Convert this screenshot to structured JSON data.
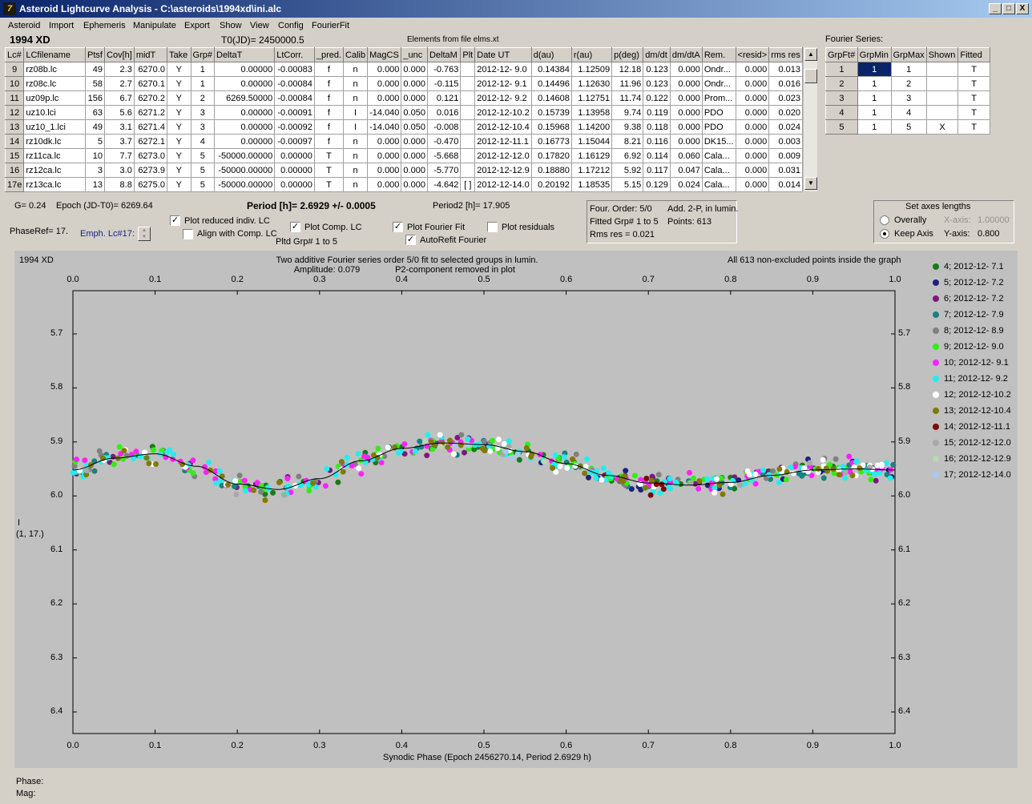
{
  "window": {
    "title": "Asteroid Lightcurve Analysis - C:\\asteroids\\1994xd\\ini.alc",
    "app_icon": "7",
    "buttons": [
      "_",
      "□",
      "X"
    ]
  },
  "menu": [
    "Asteroid",
    "Import",
    "Ephemeris",
    "Manipulate",
    "Export",
    "Show",
    "View",
    "Config",
    "FourierFit"
  ],
  "header": {
    "object": "1994 XD",
    "t0": "T0(JD)= 2450000.5",
    "elements": "Elements from file elms.xt",
    "fourier_title": "Fourier Series:"
  },
  "lc_table": {
    "columns": [
      "Lc#",
      "LCfilename",
      "Ptsf",
      "Cov[h]",
      "midT",
      "Take",
      "Grp#",
      "DeltaT",
      "LtCorr.",
      "_pred.",
      "Calib",
      "MagCS",
      "_unc",
      "DeltaM",
      "Plt",
      "Date UT",
      "d(au)",
      "r(au)",
      "p(deg)",
      "dm/dt",
      "dm/dtA",
      "Rem.",
      "<resid>",
      "rms res"
    ],
    "rows": [
      [
        "9",
        "rz08b.lc",
        "49",
        "2.3",
        "6270.0",
        "Y",
        "1",
        "0.00000",
        "-0.00083",
        "f",
        "n",
        "0.000",
        "0.000",
        "-0.763",
        "",
        "2012-12- 9.0",
        "0.14384",
        "1.12509",
        "12.18",
        "0.123",
        "0.000",
        "Ondr...",
        "0.000",
        "0.013"
      ],
      [
        "10",
        "rz08c.lc",
        "58",
        "2.7",
        "6270.1",
        "Y",
        "1",
        "0.00000",
        "-0.00084",
        "f",
        "n",
        "0.000",
        "0.000",
        "-0.115",
        "",
        "2012-12- 9.1",
        "0.14496",
        "1.12630",
        "11.96",
        "0.123",
        "0.000",
        "Ondr...",
        "0.000",
        "0.016"
      ],
      [
        "11",
        "uz09p.lc",
        "156",
        "6.7",
        "6270.2",
        "Y",
        "2",
        "6269.50000",
        "-0.00084",
        "f",
        "n",
        "0.000",
        "0.000",
        "0.121",
        "",
        "2012-12- 9.2",
        "0.14608",
        "1.12751",
        "11.74",
        "0.122",
        "0.000",
        "Prom...",
        "0.000",
        "0.023"
      ],
      [
        "12",
        "uz10.lci",
        "63",
        "5.6",
        "6271.2",
        "Y",
        "3",
        "0.00000",
        "-0.00091",
        "f",
        "I",
        "-14.040",
        "0.050",
        "0.016",
        "",
        "2012-12-10.2",
        "0.15739",
        "1.13958",
        "9.74",
        "0.119",
        "0.000",
        "PDO",
        "0.000",
        "0.020"
      ],
      [
        "13",
        "uz10_1.lci",
        "49",
        "3.1",
        "6271.4",
        "Y",
        "3",
        "0.00000",
        "-0.00092",
        "f",
        "I",
        "-14.040",
        "0.050",
        "-0.008",
        "",
        "2012-12-10.4",
        "0.15968",
        "1.14200",
        "9.38",
        "0.118",
        "0.000",
        "PDO",
        "0.000",
        "0.024"
      ],
      [
        "14",
        "rz10dk.lc",
        "5",
        "3.7",
        "6272.1",
        "Y",
        "4",
        "0.00000",
        "-0.00097",
        "f",
        "n",
        "0.000",
        "0.000",
        "-0.470",
        "",
        "2012-12-11.1",
        "0.16773",
        "1.15044",
        "8.21",
        "0.116",
        "0.000",
        "DK15...",
        "0.000",
        "0.003"
      ],
      [
        "15",
        "rz11ca.lc",
        "10",
        "7.7",
        "6273.0",
        "Y",
        "5",
        "-50000.00000",
        "0.00000",
        "T",
        "n",
        "0.000",
        "0.000",
        "-5.668",
        "",
        "2012-12-12.0",
        "0.17820",
        "1.16129",
        "6.92",
        "0.114",
        "0.060",
        "Cala...",
        "0.000",
        "0.009"
      ],
      [
        "16",
        "rz12ca.lc",
        "3",
        "3.0",
        "6273.9",
        "Y",
        "5",
        "-50000.00000",
        "0.00000",
        "T",
        "n",
        "0.000",
        "0.000",
        "-5.770",
        "",
        "2012-12-12.9",
        "0.18880",
        "1.17212",
        "5.92",
        "0.117",
        "0.047",
        "Cala...",
        "0.000",
        "0.031"
      ],
      [
        "17e",
        "rz13ca.lc",
        "13",
        "8.8",
        "6275.0",
        "Y",
        "5",
        "-50000.00000",
        "0.00000",
        "T",
        "n",
        "0.000",
        "0.000",
        "-4.642",
        "[ ]",
        "2012-12-14.0",
        "0.20192",
        "1.18535",
        "5.15",
        "0.129",
        "0.024",
        "Cala...",
        "0.000",
        "0.014"
      ]
    ]
  },
  "fourier_table": {
    "columns": [
      "GrpFt#",
      "GrpMin",
      "GrpMax",
      "Shown",
      "Fitted"
    ],
    "rows": [
      [
        "1",
        "1",
        "1",
        "",
        "T"
      ],
      [
        "2",
        "1",
        "2",
        "",
        "T"
      ],
      [
        "3",
        "1",
        "3",
        "",
        "T"
      ],
      [
        "4",
        "1",
        "4",
        "",
        "T"
      ],
      [
        "5",
        "1",
        "5",
        "X",
        "T"
      ]
    ]
  },
  "controls": {
    "g": "G= 0.24",
    "epoch": "Epoch (JD-T0)= 6269.64",
    "period": "Period [h]= 2.6929 +/- 0.0005",
    "period2": "Period2 [h]= 17.905",
    "phaseref": "PhaseRef= 17.",
    "emph": "Emph. Lc#17:",
    "plot_reduced": "Plot reduced indiv. LC",
    "align_comp": "Align with Comp. LC",
    "plot_comp": "Plot Comp. LC",
    "pltd_grp": "Pltd Grp#  1   to   5",
    "plot_fourier": "Plot Fourier Fit",
    "autorefit": "AutoRefit Fourier",
    "plot_resid": "Plot residuals"
  },
  "fitinfo": {
    "order": "Four. Order:  5/0",
    "add": "Add. 2-P, in lumin.",
    "fitted": "Fitted Grp# 1 to 5",
    "points": "Points: 613",
    "rms": "Rms res     = 0.021"
  },
  "axes_box": {
    "title": "Set axes lengths",
    "overally": "Overally",
    "keep": "Keep Axis",
    "xaxis_label": "X-axis:",
    "xaxis_value": "1.00000",
    "yaxis_label": "Y-axis:",
    "yaxis_value": "0.800"
  },
  "status": {
    "phase": "Phase:",
    "mag": "Mag:"
  },
  "chart_data": {
    "type": "scatter",
    "object_label": "1994 XD",
    "title": "Two additive Fourier series order 5/0 fit to selected groups in lumin.",
    "subtitle1": "Amplitude: 0.079",
    "subtitle2": "P2-component removed in plot",
    "note": "All 613 non-excluded points inside the graph",
    "xlabel": "Synodic Phase (Epoch 2456270.14, Period 2.6929 h)",
    "ylabel": "I",
    "ylabel2": "(1, 17.)",
    "xlim": [
      0.0,
      1.0
    ],
    "ylim": [
      5.62,
      6.44
    ],
    "y_inverted": true,
    "grid": false,
    "legend_position": "right",
    "x_ticks": [
      "0.0",
      "0.1",
      "0.2",
      "0.3",
      "0.4",
      "0.5",
      "0.6",
      "0.7",
      "0.8",
      "0.9",
      "1.0"
    ],
    "y_ticks": [
      "5.7",
      "5.8",
      "5.9",
      "6.0",
      "6.1",
      "6.2",
      "6.3",
      "6.4"
    ],
    "fit_curve": {
      "x": [
        0.0,
        0.05,
        0.1,
        0.15,
        0.2,
        0.25,
        0.3,
        0.35,
        0.4,
        0.45,
        0.5,
        0.55,
        0.6,
        0.65,
        0.7,
        0.75,
        0.8,
        0.85,
        0.9,
        0.95,
        1.0
      ],
      "y": [
        5.952,
        5.93,
        5.922,
        5.945,
        5.978,
        5.988,
        5.968,
        5.935,
        5.912,
        5.902,
        5.905,
        5.918,
        5.94,
        5.962,
        5.976,
        5.98,
        5.975,
        5.962,
        5.952,
        5.95,
        5.952
      ]
    },
    "series": [
      {
        "name": "4; 2012-12- 7.1",
        "color": "#1a7a1a",
        "x_range": [
          0.0,
          1.0
        ],
        "count": 35
      },
      {
        "name": "5; 2012-12- 7.2",
        "color": "#1a237e",
        "x_range": [
          0.55,
          1.0
        ],
        "count": 25
      },
      {
        "name": "6; 2012-12- 7.2",
        "color": "#7b1a7b",
        "x_range": [
          0.0,
          1.0
        ],
        "count": 35
      },
      {
        "name": "7; 2012-12- 7.9",
        "color": "#1a8080",
        "x_range": [
          0.0,
          1.0
        ],
        "count": 45
      },
      {
        "name": "8; 2012-12- 8.9",
        "color": "#808080",
        "x_range": [
          0.0,
          1.0
        ],
        "count": 35
      },
      {
        "name": "9; 2012-12- 9.0",
        "color": "#33ee11",
        "x_range": [
          0.0,
          1.0
        ],
        "count": 70
      },
      {
        "name": "10; 2012-12- 9.1",
        "color": "#ff22ff",
        "x_range": [
          0.0,
          1.0
        ],
        "count": 70
      },
      {
        "name": "11; 2012-12- 9.2",
        "color": "#22eeee",
        "x_range": [
          0.0,
          1.0
        ],
        "count": 115
      },
      {
        "name": "12; 2012-12-10.2",
        "color": "#ffffff",
        "x_range": [
          0.0,
          1.0
        ],
        "count": 55
      },
      {
        "name": "13; 2012-12-10.4",
        "color": "#807a00",
        "x_range": [
          0.0,
          1.0
        ],
        "count": 55
      },
      {
        "name": "14; 2012-12-11.1",
        "color": "#7a0a0a",
        "x_range": [
          0.69,
          0.72
        ],
        "count": 5
      },
      {
        "name": "15; 2012-12-12.0",
        "color": "#a8a8a8",
        "x_range": [
          0.0,
          1.0
        ],
        "count": 10
      },
      {
        "name": "16; 2012-12-12.9",
        "color": "#b8d8b0",
        "x_range": [
          0.42,
          0.6
        ],
        "count": 3
      },
      {
        "name": "17; 2012-12-14.0",
        "color": "#a8c8f0",
        "x_range": [
          0.42,
          0.6
        ],
        "count": 5
      }
    ]
  }
}
